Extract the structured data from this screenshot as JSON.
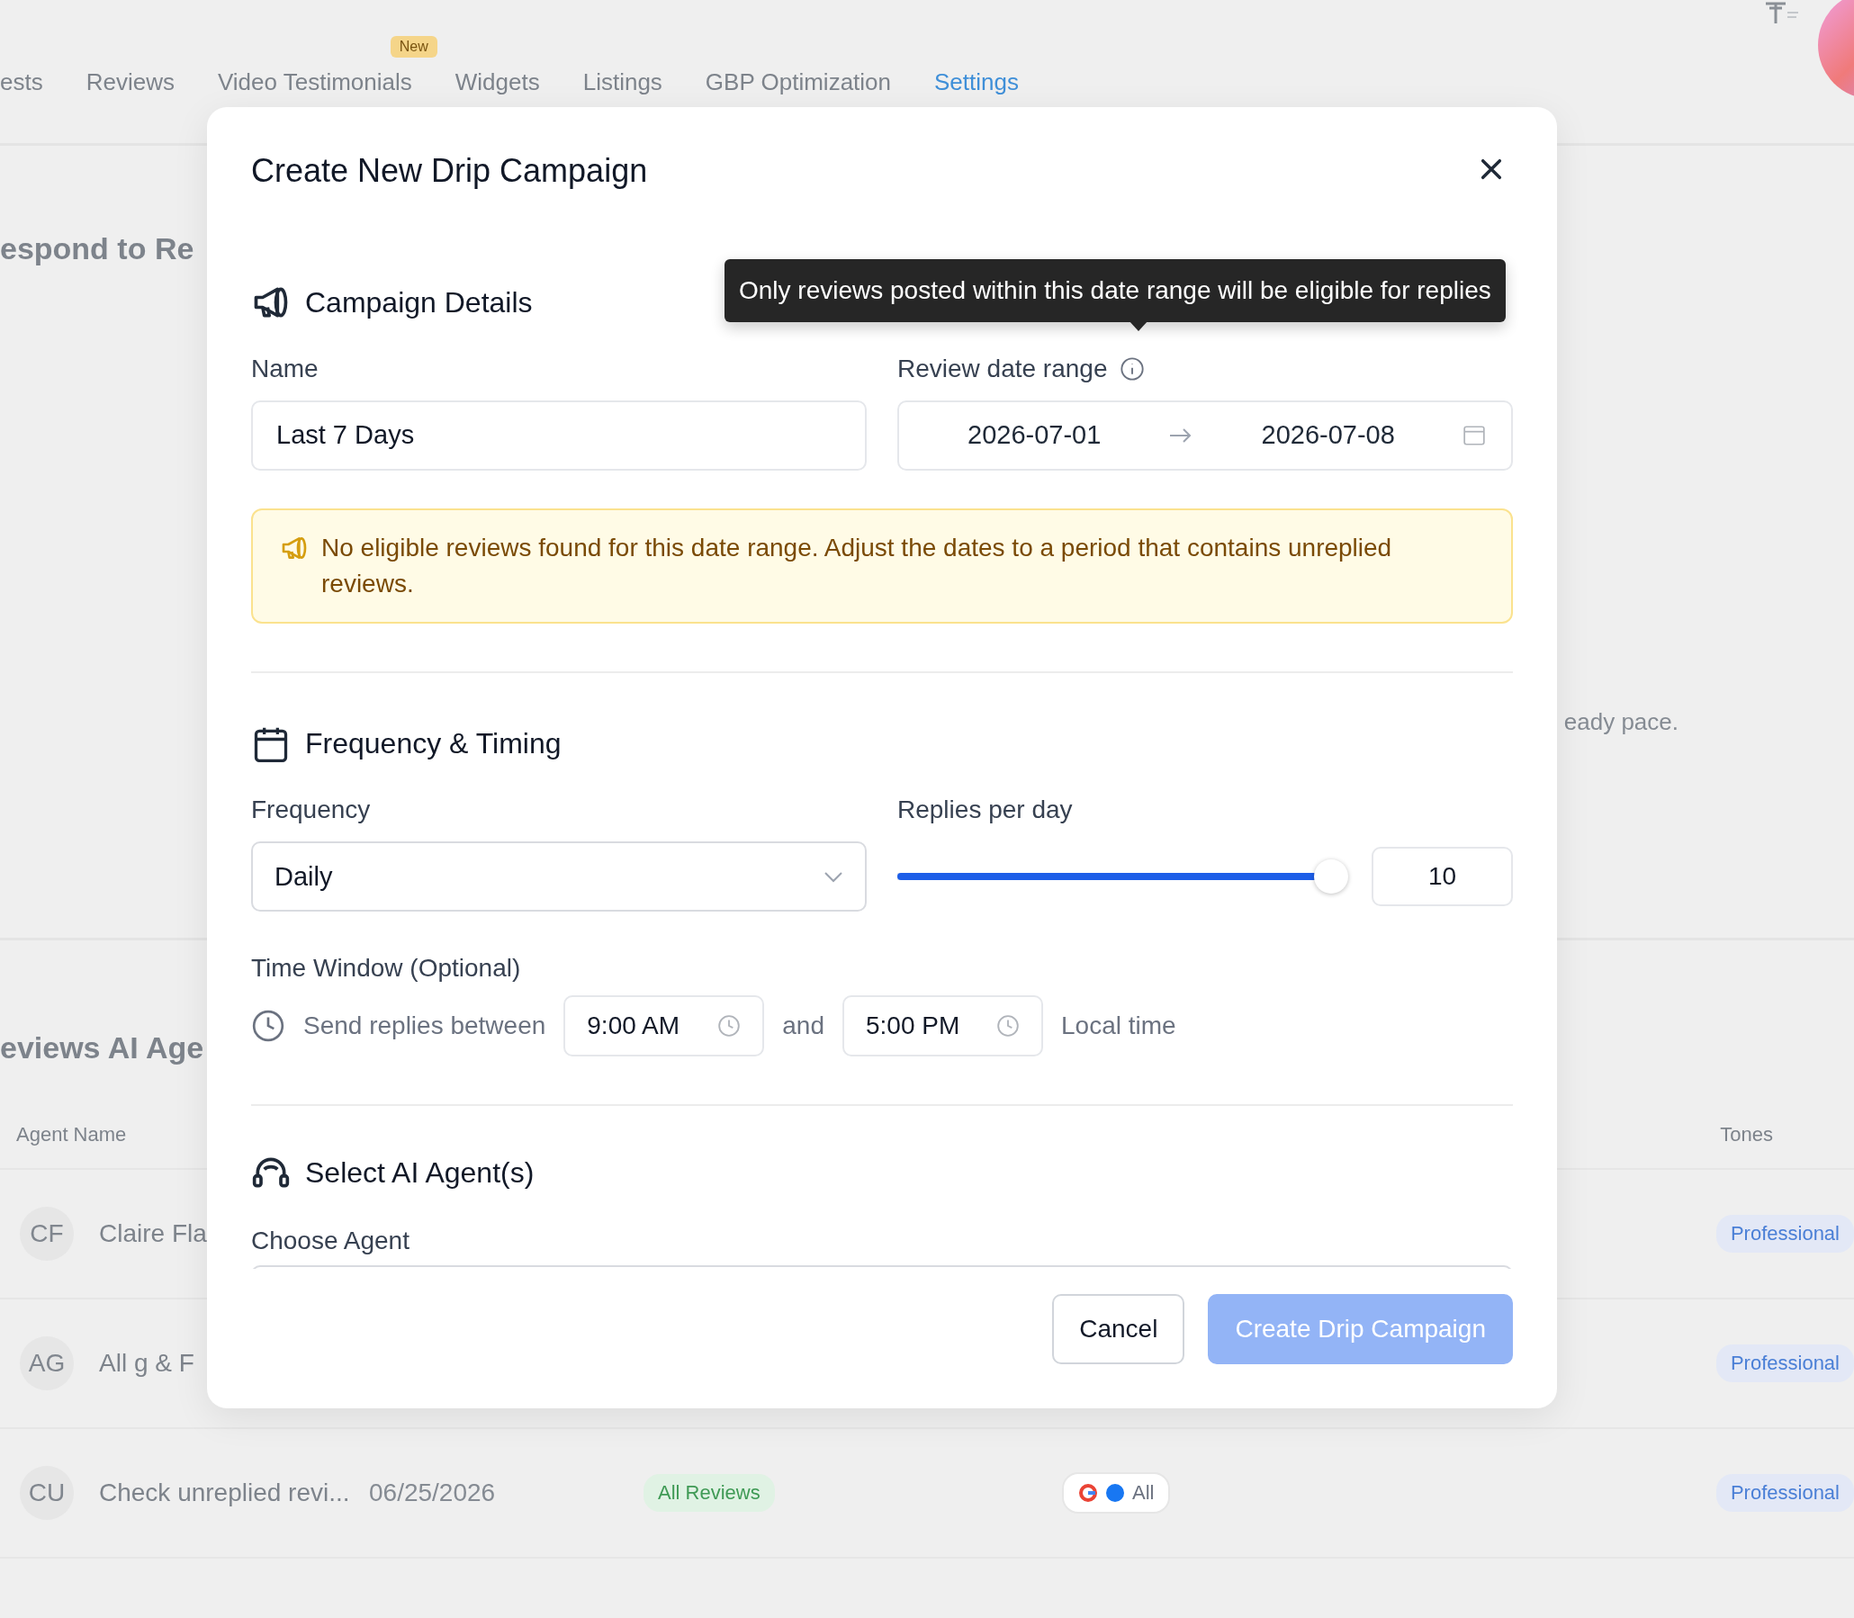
{
  "background": {
    "nav_tabs": [
      {
        "label": "ests",
        "selected": false
      },
      {
        "label": "Reviews",
        "selected": false
      },
      {
        "label": "Video Testimonials",
        "selected": false,
        "badge": "New"
      },
      {
        "label": "Widgets",
        "selected": false
      },
      {
        "label": "Listings",
        "selected": false
      },
      {
        "label": "GBP Optimization",
        "selected": false
      },
      {
        "label": "Settings",
        "selected": true
      }
    ],
    "heading_1": "espond to Re",
    "text_1": "eady pace.",
    "heading_2": "eviews AI Age",
    "table": {
      "columns": [
        "Agent Name",
        "Tones"
      ],
      "rows": [
        {
          "initials": "CF",
          "name": "Claire Fla",
          "tone": "Professional"
        },
        {
          "initials": "AG",
          "name": "All g & F",
          "tone": "Professional"
        },
        {
          "initials": "CU",
          "name": "Check unreplied revi...",
          "date": "06/25/2026",
          "filter": "All Reviews",
          "channel": "All",
          "tone": "Professional"
        }
      ]
    }
  },
  "modal": {
    "title": "Create New Drip Campaign",
    "tooltip": "Only reviews posted within this date range will be eligible for replies",
    "campaign_details": {
      "heading": "Campaign Details",
      "name_label": "Name",
      "name_value": "Last 7 Days",
      "date_label": "Review date range",
      "date_start": "2026-07-01",
      "date_end": "2026-07-08",
      "alert": "No eligible reviews found for this date range. Adjust the dates to a period that contains unreplied reviews."
    },
    "frequency_timing": {
      "heading": "Frequency & Timing",
      "frequency_label": "Frequency",
      "frequency_value": "Daily",
      "replies_label": "Replies per day",
      "replies": {
        "level": 0.97,
        "value": "10"
      },
      "time_window_label": "Time Window (Optional)",
      "send_label": "Send replies between",
      "start_time": "9:00 AM",
      "and": "and",
      "end_time": "5:00 PM",
      "local_time": "Local time"
    },
    "agents": {
      "heading": "Select AI Agent(s)",
      "choose_label": "Choose Agent"
    },
    "buttons": [
      {
        "label": "Cancel",
        "kind": "secondary",
        "disabled": false
      },
      {
        "label": "Create Drip Campaign",
        "kind": "primary",
        "disabled": true
      }
    ]
  }
}
